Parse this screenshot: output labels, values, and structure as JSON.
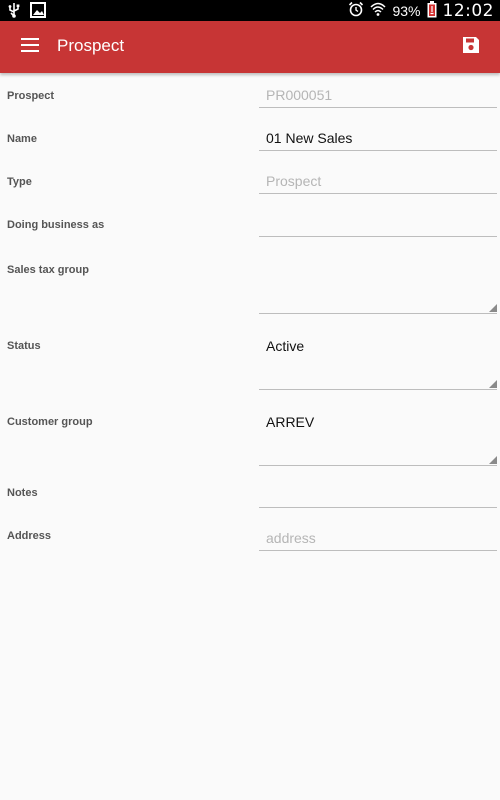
{
  "status_bar": {
    "battery": "93%",
    "time": "12:02",
    "icons": [
      "usb-icon",
      "image-icon",
      "alarm-icon",
      "wifi-icon",
      "battery-icon"
    ]
  },
  "app_bar": {
    "title": "Prospect",
    "menu_icon": "hamburger-menu-icon",
    "save_icon": "save-icon"
  },
  "form": {
    "prospect": {
      "label": "Prospect",
      "value": "PR000051"
    },
    "name": {
      "label": "Name",
      "value": "01 New Sales"
    },
    "type": {
      "label": "Type",
      "value": "Prospect"
    },
    "doing_business_as": {
      "label": "Doing business as",
      "value": ""
    },
    "sales_tax_group": {
      "label": "Sales tax group",
      "value": ""
    },
    "status": {
      "label": "Status",
      "value": "Active"
    },
    "customer_group": {
      "label": "Customer group",
      "value": "ARREV"
    },
    "notes": {
      "label": "Notes",
      "value": ""
    },
    "address": {
      "label": "Address",
      "placeholder": "address"
    }
  },
  "colors": {
    "app_bar": "#c73535",
    "status_bar": "#000000",
    "background": "#fafafa"
  }
}
